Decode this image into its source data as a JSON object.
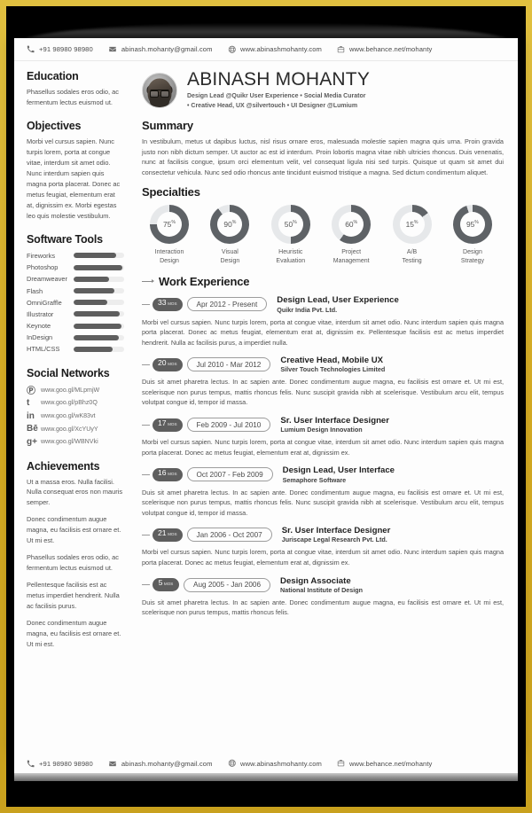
{
  "contact": [
    {
      "icon": "phone-icon",
      "text": "+91 98980 98980"
    },
    {
      "icon": "email-icon",
      "text": "abinash.mohanty@gmail.com"
    },
    {
      "icon": "globe-icon",
      "text": "www.abinashmohanty.com"
    },
    {
      "icon": "portfolio-icon",
      "text": "www.behance.net/mohanty"
    }
  ],
  "profile": {
    "name": "ABINASH MOHANTY",
    "subtitle_line1": "Design Lead @Quikr User Experience • Social Media Curator",
    "subtitle_line2": "• Creative Head, UX @silvertouch • UI Designer @Lumium"
  },
  "sidebar": {
    "education": {
      "title": "Education",
      "text": "Phasellus sodales eros odio, ac fermentum lectus euismod ut."
    },
    "objectives": {
      "title": "Objectives",
      "text": "Morbi vel cursus sapien. Nunc turpis lorem, porta at congue vitae, interdum sit amet odio. Nunc interdum sapien quis magna porta placerat. Donec ac metus feugiat, elementum erat at, dignissim ex. Morbi egestas leo quis molestie vestibulum."
    },
    "software_tools": {
      "title": "Software Tools",
      "items": [
        {
          "name": "Fireworks",
          "level": 85
        },
        {
          "name": "Photoshop",
          "level": 97
        },
        {
          "name": "Dreamweaver",
          "level": 70
        },
        {
          "name": "Flash",
          "level": 80
        },
        {
          "name": "OmniGraffle",
          "level": 66
        },
        {
          "name": "Illustrator",
          "level": 92
        },
        {
          "name": "Keynote",
          "level": 95
        },
        {
          "name": "InDesign",
          "level": 90
        },
        {
          "name": "HTML/CSS",
          "level": 78
        }
      ]
    },
    "social_networks": {
      "title": "Social Networks",
      "items": [
        {
          "icon": "pinterest-icon",
          "glyph": "Ⓟ",
          "url": "www.goo.gl/MLpmjW"
        },
        {
          "icon": "twitter-icon",
          "glyph": "t",
          "url": "www.goo.gl/pBhz0Q"
        },
        {
          "icon": "linkedin-icon",
          "glyph": "in",
          "url": "www.goo.gl/wK83vt"
        },
        {
          "icon": "behance-icon",
          "glyph": "Bē",
          "url": "www.goo.gl/XcYUyY"
        },
        {
          "icon": "googleplus-icon",
          "glyph": "g+",
          "url": "www.goo.gl/WBNVki"
        }
      ]
    },
    "achievements": {
      "title": "Achievements",
      "paragraphs": [
        "Ut a massa eros. Nulla facilisi. Nulla consequat eros non mauris semper.",
        "Donec condimentum augue magna, eu facilisis est ornare et. Ut mi est.",
        "Phasellus sodales eros odio, ac fermentum lectus euismod ut.",
        "Pellentesque facilisis est ac metus imperdiet hendrerit. Nulla ac facilisis purus.",
        "Donec condimentum augue magna, eu facilisis est ornare et. Ut mi est."
      ]
    }
  },
  "summary": {
    "title": "Summary",
    "text": "In vestibulum, metus ut dapibus luctus, nisl risus ornare eros, malesuada molestie sapien magna quis urna. Proin gravida justo non nibh dictum semper. Ut auctor ac est id interdum. Proin lobortis magna vitae nibh ultricies rhoncus. Duis venenatis, nunc at facilisis congue, ipsum orci elementum velit, vel consequat ligula nisi sed turpis. Quisque ut quam sit amet dui consectetur vehicula. Nunc sed odio rhoncus ante tincidunt euismod tristique a magna. Sed dictum condimentum aliquet."
  },
  "specialties": {
    "title": "Specialties"
  },
  "chart_data": {
    "type": "pie",
    "title": "Specialties",
    "subtype": "donut-gauges",
    "unit": "%",
    "categories": [
      "Interaction Design",
      "Visual Design",
      "Heuristic Evaluation",
      "Project Management",
      "A/B Testing",
      "Design Strategy"
    ],
    "values": [
      75,
      90,
      50,
      60,
      15,
      95
    ],
    "labels": [
      "75",
      "90",
      "50",
      "60",
      "15",
      "95"
    ],
    "label_lines": [
      [
        "Interaction",
        "Design"
      ],
      [
        "Visual",
        "Design"
      ],
      [
        "Heuristic",
        "Evaluation"
      ],
      [
        "Project",
        "Management"
      ],
      [
        "A/B",
        "Testing"
      ],
      [
        "Design",
        "Strategy"
      ]
    ],
    "ylim": [
      0,
      100
    ],
    "grid": false,
    "legend": "none",
    "track_color": "#e6e8ea",
    "fill_color": "#5e6266"
  },
  "work": {
    "title": "Work Experience",
    "mos_label": "MOS",
    "jobs": [
      {
        "months": "33",
        "dates": "Apr 2012 - Present",
        "title": "Design Lead, User Experience",
        "company": "Quikr India Pvt. Ltd.",
        "desc": "Morbi vel cursus sapien. Nunc turpis lorem, porta at congue vitae, interdum sit amet odio. Nunc interdum sapien quis magna porta placerat. Donec ac metus feugiat, elementum erat at, dignissim ex. Pellentesque facilisis est ac metus imperdiet hendrerit. Nulla ac facilisis purus, a imperdiet nulla."
      },
      {
        "months": "20",
        "dates": "Jul 2010 - Mar 2012",
        "title": "Creative Head, Mobile UX",
        "company": "Silver Touch Technologies Limited",
        "desc": "Duis sit amet pharetra lectus. In ac sapien ante. Donec condimentum augue magna, eu facilisis est ornare et. Ut mi est, scelerisque non purus tempus, mattis rhoncus felis. Nunc suscipit gravida nibh at scelerisque. Vestibulum arcu elit, tempus volutpat congue id, tempor id massa."
      },
      {
        "months": "17",
        "dates": "Feb 2009 - Jul 2010",
        "title": "Sr. User Interface Designer",
        "company": "Lumium Design Innovation",
        "desc": "Morbi vel cursus sapien. Nunc turpis lorem, porta at congue vitae, interdum sit amet odio. Nunc interdum sapien quis magna porta placerat. Donec ac metus feugiat, elementum erat at, dignissim ex."
      },
      {
        "months": "16",
        "dates": "Oct 2007 - Feb 2009",
        "title": "Design Lead, User Interface",
        "company": "Semaphore Software",
        "desc": "Duis sit amet pharetra lectus. In ac sapien ante. Donec condimentum augue magna, eu facilisis est ornare et. Ut mi est, scelerisque non purus tempus, mattis rhoncus felis. Nunc suscipit gravida nibh at scelerisque. Vestibulum arcu elit, tempus volutpat congue id, tempor id massa."
      },
      {
        "months": "21",
        "dates": "Jan 2006 - Oct 2007",
        "title": "Sr. User Interface Designer",
        "company": "Juriscape Legal Research Pvt. Ltd.",
        "desc": "Morbi vel cursus sapien. Nunc turpis lorem, porta at congue vitae, interdum sit amet odio. Nunc interdum sapien quis magna porta placerat. Donec ac metus feugiat, elementum erat at, dignissim ex."
      },
      {
        "months": "5",
        "dates": "Aug 2005 - Jan 2006",
        "title": "Design Associate",
        "company": "National Institute of Design",
        "desc": "Duis sit amet pharetra lectus. In ac sapien ante. Donec condimentum augue magna, eu facilisis est ornare et. Ut mi est, scelerisque non purus tempus, mattis rhoncus felis."
      }
    ]
  }
}
